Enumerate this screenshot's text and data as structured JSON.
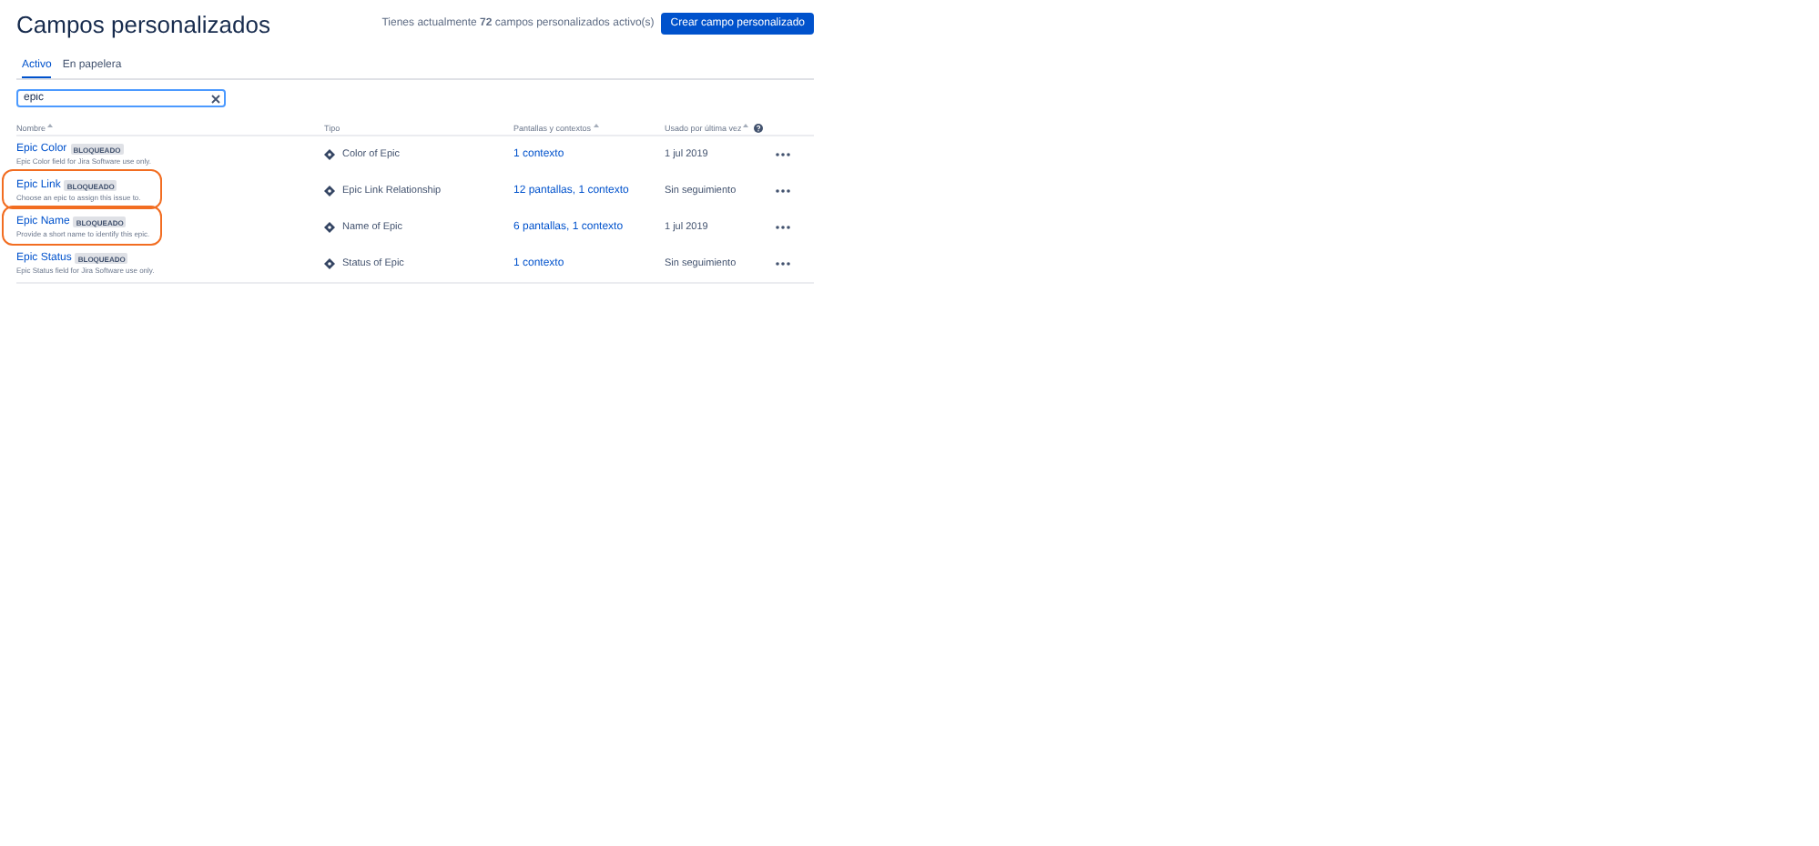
{
  "header": {
    "title": "Campos personalizados",
    "summary": "Tienes actualmente **72** campos personalizados activo(s)",
    "create_button": "Crear campo personalizado"
  },
  "tabs": [
    {
      "label": "Activo",
      "selected": true
    },
    {
      "label": "En papelera",
      "selected": false
    }
  ],
  "search": {
    "value": "epic"
  },
  "table": {
    "columns": [
      {
        "label": "Nombre",
        "sortable": true
      },
      {
        "label": "Tipo",
        "sortable": false
      },
      {
        "label": "Pantallas y contextos",
        "sortable": true
      },
      {
        "label": "Usado por última vez",
        "sortable": true,
        "help": true
      }
    ],
    "rows": [
      {
        "name": "Epic Color",
        "badge": "BLOQUEADO",
        "description": "Epic Color field for Jira Software use only.",
        "type": "Color of Epic",
        "screens": "1 contexto",
        "last_used": "1 jul 2019",
        "highlighted": false
      },
      {
        "name": "Epic Link",
        "badge": "BLOQUEADO",
        "description": "Choose an epic to assign this issue to.",
        "type": "Epic Link Relationship",
        "screens": "12 pantallas, 1 contexto",
        "last_used": "Sin seguimiento",
        "highlighted": true
      },
      {
        "name": "Epic Name",
        "badge": "BLOQUEADO",
        "description": "Provide a short name to identify this epic.",
        "type": "Name of Epic",
        "screens": "6 pantallas, 1 contexto",
        "last_used": "1 jul 2019",
        "highlighted": true
      },
      {
        "name": "Epic Status",
        "badge": "BLOQUEADO",
        "description": "Epic Status field for Jira Software use only.",
        "type": "Status of Epic",
        "screens": "1 contexto",
        "last_used": "Sin seguimiento",
        "highlighted": false
      }
    ]
  }
}
